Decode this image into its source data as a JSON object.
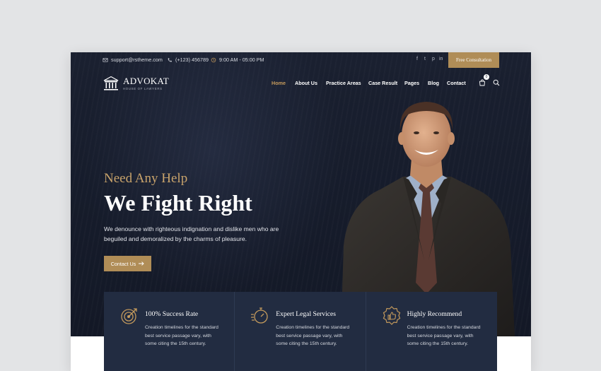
{
  "topbar": {
    "email": "support@rstheme.com",
    "phone": "(+123) 456789",
    "hours": "9:00 AM - 05:00 PM",
    "social": [
      "f",
      "t",
      "p",
      "in"
    ],
    "cta_label": "Free Consultation"
  },
  "logo": {
    "name": "ADVOKAT",
    "tagline": "HOUSE OF LAWYERS"
  },
  "nav": {
    "items": [
      "Home",
      "About Us",
      "Practice Areas",
      "Case Result",
      "Pages",
      "Blog",
      "Contact"
    ],
    "active": "Home",
    "cart_count": "0"
  },
  "hero": {
    "eyebrow": "Need Any Help",
    "headline": "We Fight Right",
    "description": "We denounce with righteous indignation and dislike men who are beguiled and demoralized by the charms of pleasure.",
    "button_label": "Contact Us"
  },
  "features": [
    {
      "title": "100% Success Rate",
      "text": "Creation timelines for the standard best service passage vary, with some citing the 15th century.",
      "icon": "target-icon"
    },
    {
      "title": "Expert Legal Services",
      "text": "Creation timelines for the standard best service passage vary, with some citing the 15th century.",
      "icon": "stopwatch-icon"
    },
    {
      "title": "Highly Recommend",
      "text": "Creation timelines for the standard best service passage vary, with some citing the 15th century.",
      "icon": "thumbs-up-badge-icon"
    }
  ],
  "colors": {
    "accent": "#b08d57",
    "accent_text": "#c49a5c",
    "hero_bg": "#161c2b",
    "feature_bg": "#222c41"
  }
}
